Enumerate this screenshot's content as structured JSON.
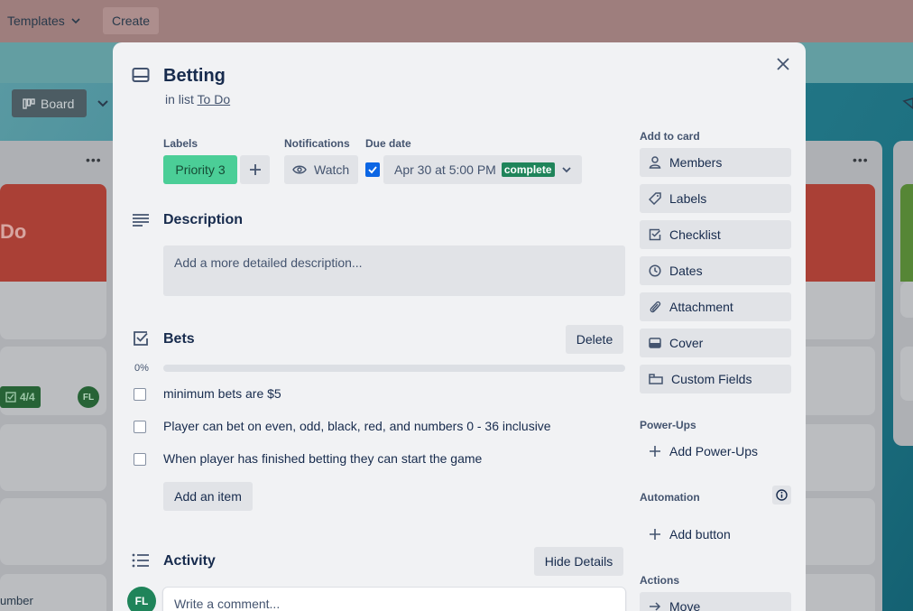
{
  "topbar": {
    "templates_label": "Templates",
    "create_label": "Create"
  },
  "board": {
    "view_label": "Board",
    "todo_cover_text": "Do",
    "checklist_badge": "4/4",
    "member_initials": "FL",
    "card_text_fragment": "umber"
  },
  "card": {
    "title": "Betting",
    "in_list_prefix": "in list",
    "list_name": "To Do",
    "labels_heading": "Labels",
    "label_name": "Priority 3",
    "notifications_heading": "Notifications",
    "watch_label": "Watch",
    "due_heading": "Due date",
    "due_value": "Apr 30 at 5:00 PM",
    "due_status": "complete",
    "description_heading": "Description",
    "description_placeholder": "Add a more detailed description...",
    "checklist": {
      "title": "Bets",
      "delete_label": "Delete",
      "progress_text": "0%",
      "progress_value": 0,
      "items": [
        {
          "text": "minimum bets are $5",
          "checked": false
        },
        {
          "text": "Player can bet on even, odd, black, red, and numbers 0 - 36 inclusive",
          "checked": false
        },
        {
          "text": "When player has finished betting they can start the game",
          "checked": false
        }
      ],
      "add_item_label": "Add an item"
    },
    "activity_heading": "Activity",
    "hide_details_label": "Hide Details",
    "comment_avatar": "FL",
    "comment_placeholder": "Write a comment..."
  },
  "sidebar": {
    "add_to_card_heading": "Add to card",
    "add_buttons": [
      "Members",
      "Labels",
      "Checklist",
      "Dates",
      "Attachment",
      "Cover",
      "Custom Fields"
    ],
    "powerups_heading": "Power-Ups",
    "add_powerups_label": "Add Power-Ups",
    "automation_heading": "Automation",
    "add_button_label": "Add button",
    "actions_heading": "Actions",
    "move_label": "Move"
  },
  "colors": {
    "label_green": "#4bce97",
    "complete_green": "#1f845a",
    "checkbox_blue": "#0c66e4"
  }
}
